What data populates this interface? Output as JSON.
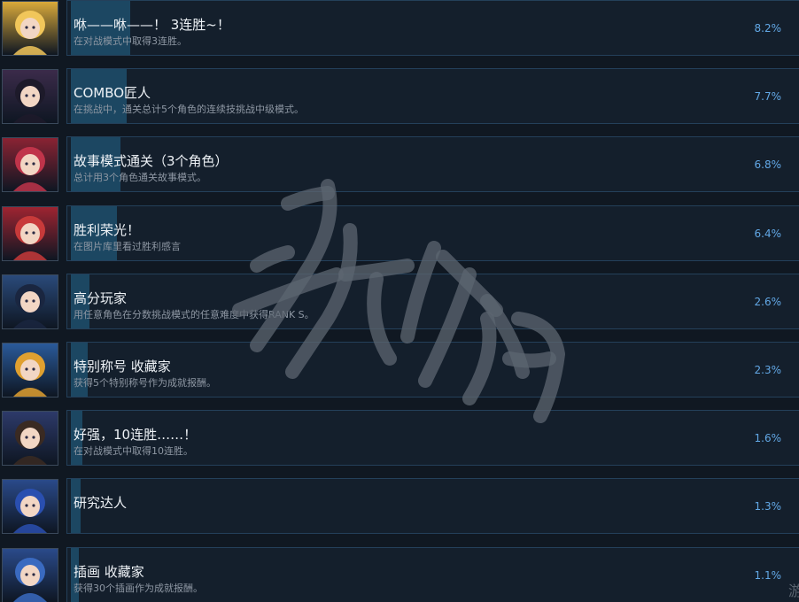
{
  "achievements": [
    {
      "title": "咻——咻——！ 3连胜~！",
      "desc": "在对战模式中取得3连胜。",
      "percent": "8.2%",
      "progress": 8.2,
      "icon": "character-portrait-icon",
      "accent": "#d9a93a",
      "hair": "#f1c65a"
    },
    {
      "title": "COMBO匠人",
      "desc": "在挑战中，通关总计5个角色的连续技挑战中级模式。",
      "percent": "7.7%",
      "progress": 7.7,
      "icon": "character-portrait-icon",
      "accent": "#3b2b4a",
      "hair": "#1d1a2a"
    },
    {
      "title": "故事模式通关（3个角色）",
      "desc": "总计用3个角色通关故事模式。",
      "percent": "6.8%",
      "progress": 6.8,
      "icon": "character-group-icon",
      "accent": "#8a2333",
      "hair": "#c0344a"
    },
    {
      "title": "胜利荣光！",
      "desc": "在图片库里看过胜利感言",
      "percent": "6.4%",
      "progress": 6.4,
      "icon": "character-portrait-icon",
      "accent": "#9e2431",
      "hair": "#c83a3a"
    },
    {
      "title": "高分玩家",
      "desc": "用任意角色在分数挑战模式的任意难度中获得RANK S。",
      "percent": "2.6%",
      "progress": 2.6,
      "icon": "character-portrait-icon",
      "accent": "#2a4a7a",
      "hair": "#1a2640"
    },
    {
      "title": "特别称号 收藏家",
      "desc": "获得5个特别称号作为成就报酬。",
      "percent": "2.3%",
      "progress": 2.3,
      "icon": "title-list-icon",
      "accent": "#2a5a9a",
      "hair": "#e0a030"
    },
    {
      "title": "好强，10连胜……！",
      "desc": "在对战模式中取得10连胜。",
      "percent": "1.6%",
      "progress": 1.6,
      "icon": "character-portrait-icon",
      "accent": "#2d3a6a",
      "hair": "#3a2a22"
    },
    {
      "title": "研究达人",
      "desc": "",
      "percent": "1.3%",
      "progress": 1.3,
      "icon": "character-portrait-icon",
      "accent": "#2a4a8a",
      "hair": "#2a4fb0"
    },
    {
      "title": "插画 收藏家",
      "desc": "获得30个插画作为成就报酬。",
      "percent": "1.1%",
      "progress": 1.1,
      "icon": "gallery-icon",
      "accent": "#2a4a8a",
      "hair": "#3a6ac0"
    }
  ],
  "watermark": "游侠网",
  "corner_mark": "游"
}
